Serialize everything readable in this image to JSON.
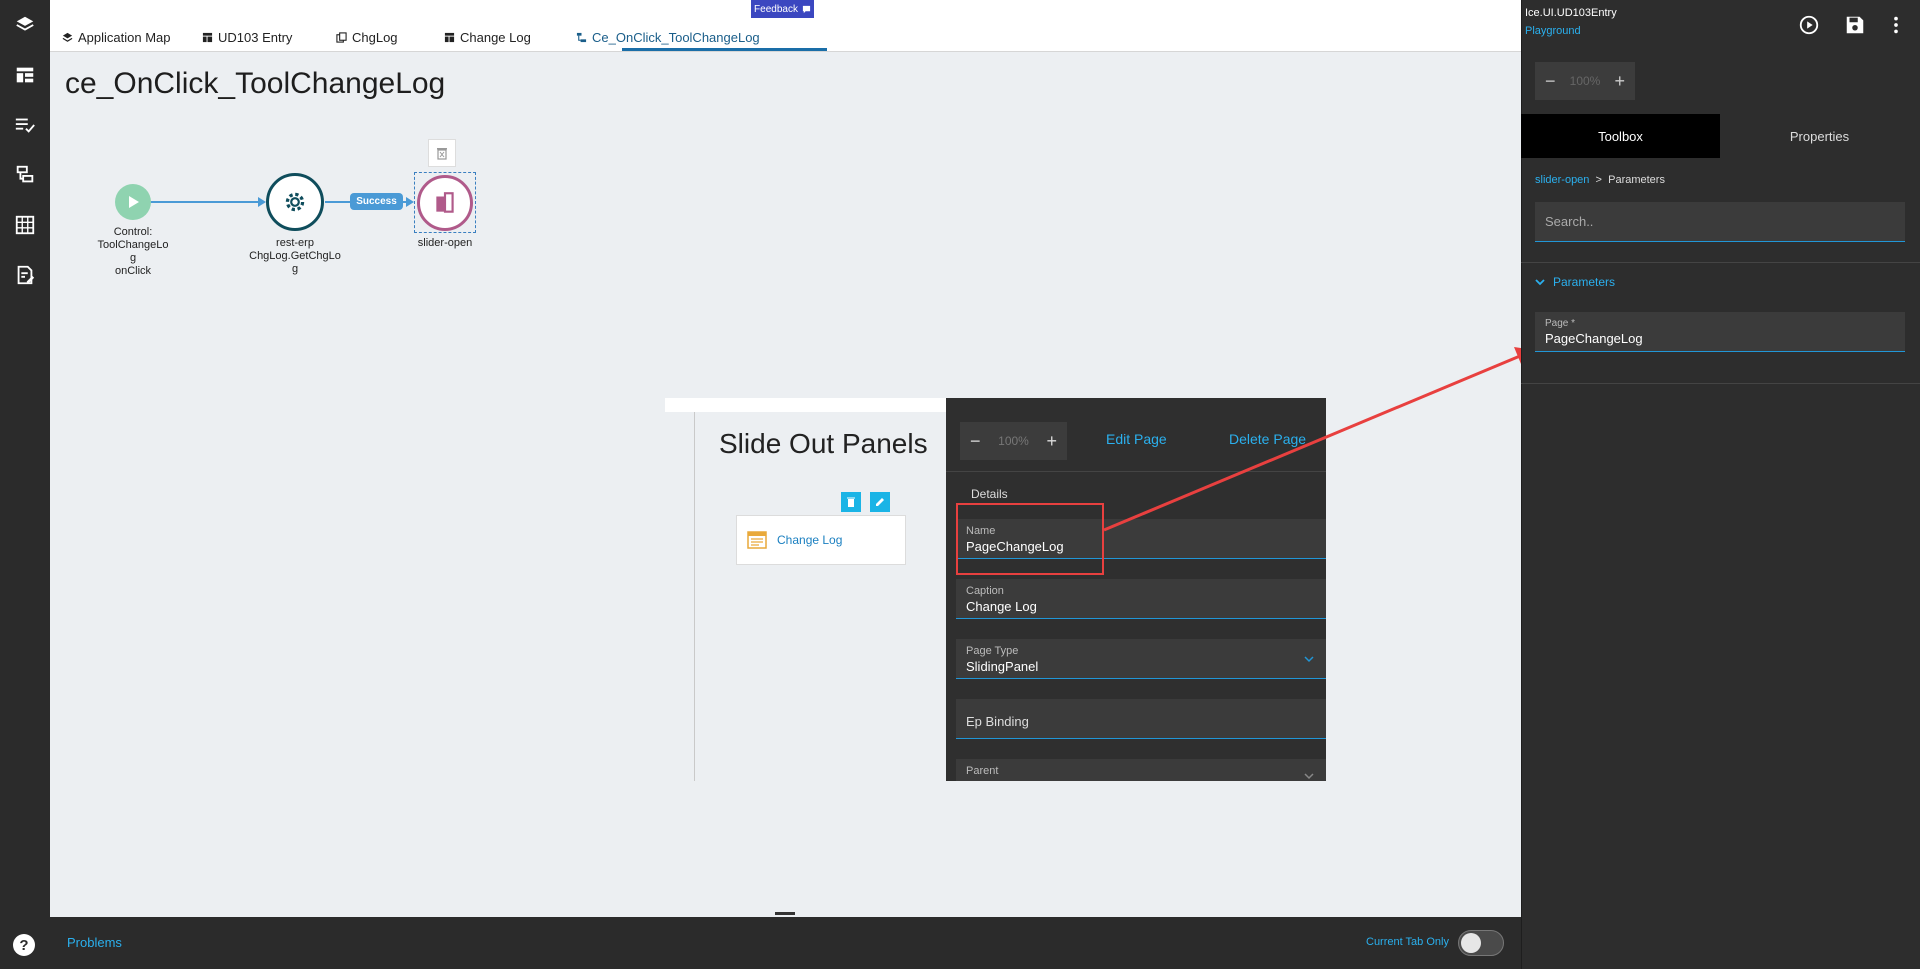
{
  "tabs": [
    {
      "label": "Application Map"
    },
    {
      "label": "UD103 Entry"
    },
    {
      "label": "ChgLog"
    },
    {
      "label": "Change Log"
    },
    {
      "label": "Ce_OnClick_ToolChangeLog"
    }
  ],
  "feedback": {
    "label": "Feedback"
  },
  "canvas": {
    "title": "ce_OnClick_ToolChangeLog",
    "nodes": {
      "start": {
        "line1": "Control:",
        "line2": "ToolChangeLo",
        "line3": "g",
        "line4": "onClick"
      },
      "rest": {
        "line1": "rest-erp",
        "line2": "ChgLog.GetChgLo",
        "line3": "g"
      },
      "slider": {
        "label": "slider-open"
      }
    },
    "success_label": "Success"
  },
  "preview": {
    "title": "Slide Out Panels",
    "card_label": "Change Log",
    "zoom": {
      "minus": "−",
      "value": "100%",
      "plus": "+"
    },
    "edit_page": "Edit Page",
    "delete_page": "Delete Page",
    "details": "Details",
    "fields": {
      "name": {
        "label": "Name",
        "value": "PageChangeLog"
      },
      "caption": {
        "label": "Caption",
        "value": "Change Log"
      },
      "page_type": {
        "label": "Page Type",
        "value": "SlidingPanel"
      },
      "ep_binding": {
        "placeholder": "Ep Binding"
      },
      "parent": {
        "label": "Parent"
      }
    }
  },
  "bottom": {
    "problems": "Problems",
    "current_tab_only": "Current Tab Only",
    "help": "?"
  },
  "right_panel": {
    "app_name": "Ice.UI.UD103Entry",
    "environment": "Playground",
    "zoom": {
      "minus": "−",
      "value": "100%",
      "plus": "+"
    },
    "tabs": {
      "toolbox": "Toolbox",
      "properties": "Properties"
    },
    "breadcrumb": {
      "link": "slider-open",
      "separator": ">",
      "current": "Parameters"
    },
    "search": {
      "placeholder": "Search.."
    },
    "section": "Parameters",
    "page_field": {
      "label": "Page *",
      "value": "PageChangeLog"
    }
  },
  "colors": {
    "accent": "#2bb0ee",
    "highlight": "#e8403f",
    "flow_line": "#4a9ad6",
    "start_node": "#8fd3b0",
    "rest_node": "#0f4d5c",
    "slider_node": "#b05a8a"
  }
}
